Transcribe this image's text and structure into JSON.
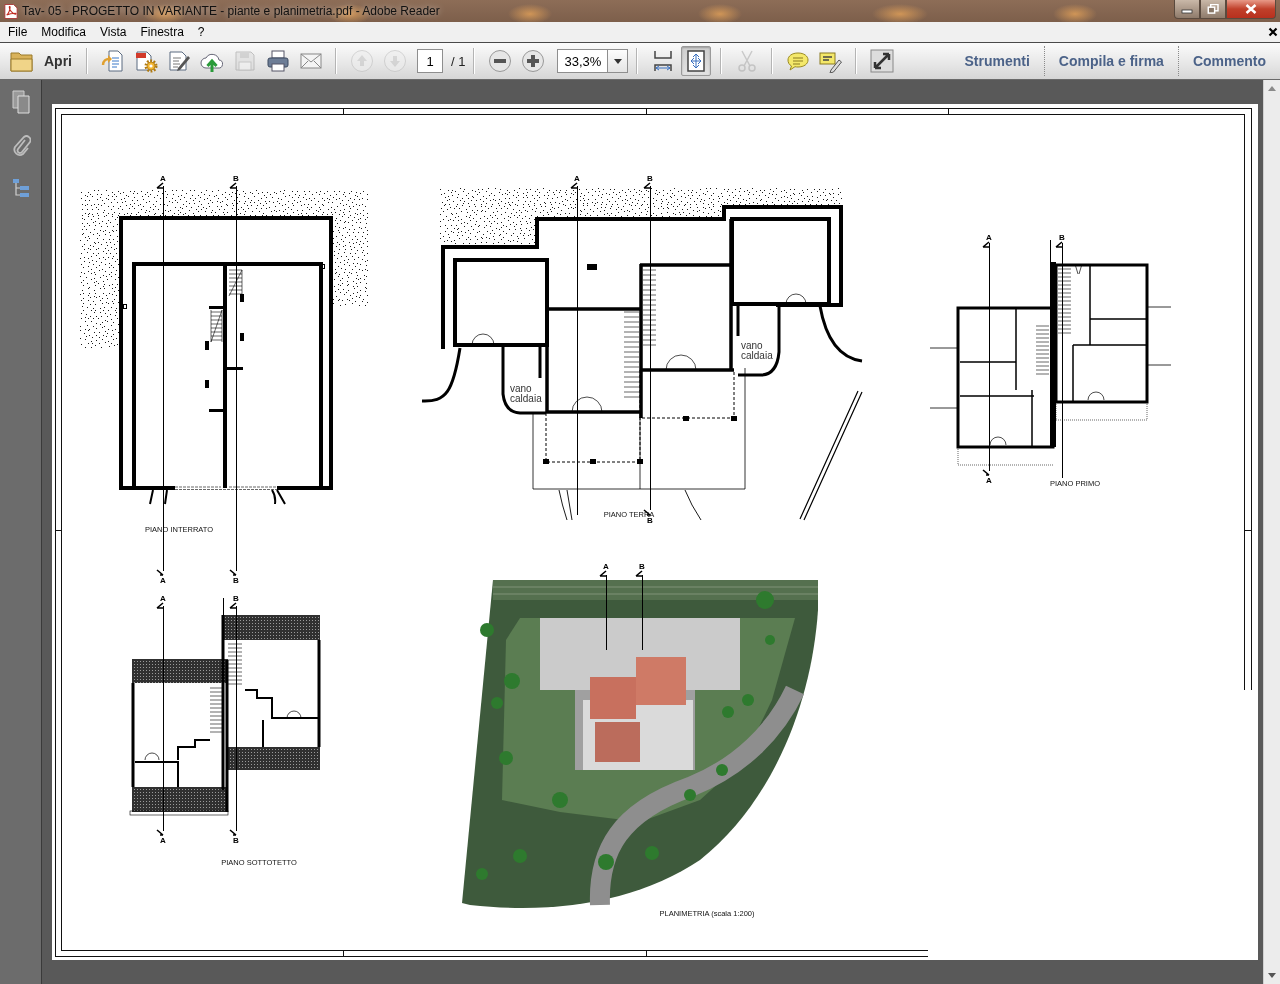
{
  "window": {
    "title": "Tav- 05 - PROGETTO IN VARIANTE - piante e planimetria.pdf - Adobe Reader"
  },
  "menu": [
    "File",
    "Modifica",
    "Vista",
    "Finestra",
    "?"
  ],
  "toolbar": {
    "open_label": "Apri",
    "groups": [
      [
        {
          "kind": "create",
          "disabled": false
        },
        {
          "kind": "combine",
          "disabled": false
        },
        {
          "kind": "sign",
          "disabled": false
        },
        {
          "kind": "upload",
          "disabled": false
        },
        {
          "kind": "save",
          "disabled": true
        },
        {
          "kind": "print",
          "disabled": false
        },
        {
          "kind": "mail",
          "disabled": false
        }
      ],
      [
        {
          "kind": "prev",
          "disabled": true
        },
        {
          "kind": "next",
          "disabled": true
        },
        {
          "kind": "page",
          "value": "1",
          "total": "/ 1"
        }
      ],
      [
        {
          "kind": "zoomout",
          "disabled": false
        },
        {
          "kind": "zoomin",
          "disabled": false
        },
        {
          "kind": "zoom",
          "value": "33,3%"
        }
      ],
      [
        {
          "kind": "fitwidth",
          "selected": false
        },
        {
          "kind": "fitpage",
          "selected": true
        }
      ],
      [
        {
          "kind": "cut",
          "disabled": true
        }
      ],
      [
        {
          "kind": "comment",
          "disabled": false
        },
        {
          "kind": "highlight",
          "disabled": false
        }
      ],
      [
        {
          "kind": "fullscreen",
          "disabled": false
        }
      ]
    ],
    "panels": [
      "Strumenti",
      "Compila e firma",
      "Commento"
    ]
  },
  "document": {
    "drawings": [
      {
        "kind": "interrato",
        "title": "PIANO INTERRATO",
        "marks": [
          "A",
          "B",
          "A",
          "B"
        ]
      },
      {
        "kind": "terra",
        "title": "PIANO TERRA",
        "marks": [
          "A",
          "B",
          "B"
        ],
        "notes": [
          "vano caldaia",
          "vano caldaia"
        ]
      },
      {
        "kind": "primo",
        "title": "PIANO PRIMO",
        "marks": [
          "A",
          "B",
          "A"
        ]
      },
      {
        "kind": "sottotetto",
        "title": "PIANO SOTTOTETTO",
        "marks": [
          "A",
          "B",
          "A",
          "B"
        ]
      },
      {
        "kind": "planimetria",
        "title": "PLANIMETRIA (scala 1:200)",
        "marks": [
          "A",
          "B"
        ]
      }
    ]
  }
}
